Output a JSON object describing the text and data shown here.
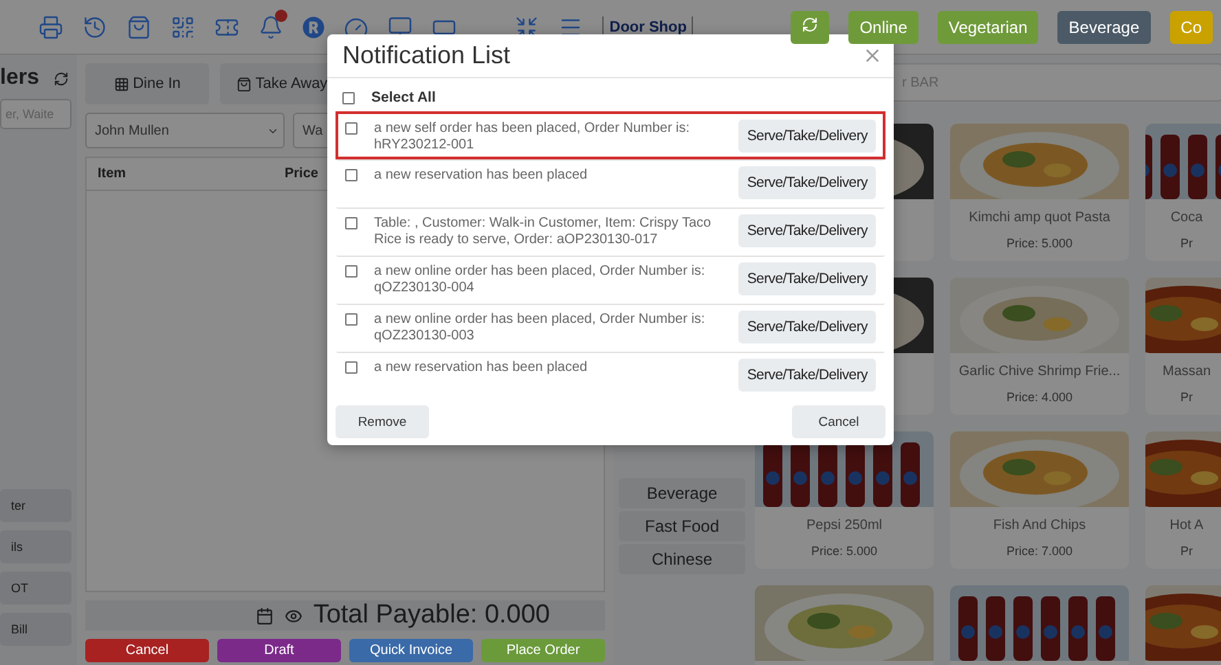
{
  "topbar": {
    "shop": "Door Shop",
    "badge": true,
    "filters": [
      {
        "label": "Online",
        "color": "#6f9a3a"
      },
      {
        "label": "Vegetarian",
        "color": "#6f9a3a"
      },
      {
        "label": "Beverage",
        "color": "#4b5a66"
      },
      {
        "label": "Co",
        "color": "#c9a200"
      }
    ]
  },
  "orders_panel": {
    "title": "lers",
    "search_placeholder": "er, Waite",
    "actions": [
      "ter",
      "ils",
      "OT",
      "Bill"
    ]
  },
  "order": {
    "tabs": [
      {
        "label": "Dine In",
        "kind": "table",
        "selected": false
      },
      {
        "label": "Take Away",
        "kind": "bag",
        "selected": false
      }
    ],
    "customer": "John Mullen",
    "waiter": "Wa",
    "columns": [
      "Item",
      "Price"
    ],
    "total": "Total Payable: 0.000",
    "buttons": [
      {
        "label": "Cancel",
        "color": "#a82222"
      },
      {
        "label": "Draft",
        "color": "#7b2a8a"
      },
      {
        "label": "Quick Invoice",
        "color": "#3a6aa8"
      },
      {
        "label": "Place Order",
        "color": "#6a9a3a"
      }
    ]
  },
  "categories": [
    {
      "label": "Beverage"
    },
    {
      "label": "Fast Food"
    },
    {
      "label": "Chinese"
    }
  ],
  "product_search": {
    "placeholder": "r BAR"
  },
  "products": [
    {
      "kind": "picture"
    },
    {
      "kind": "picture",
      "name": "Kimchi amp quot Pasta",
      "price": "Price: 5.000"
    },
    {
      "kind": "picture",
      "name": "Coca",
      "price": "Pr"
    },
    {
      "kind": "picture"
    },
    {
      "kind": "picture",
      "name": "Garlic Chive Shrimp Frie...",
      "price": "Price: 4.000"
    },
    {
      "kind": "picture",
      "name": "Massan",
      "price": "Pr"
    },
    {
      "kind": "picture",
      "name": "Pepsi 250ml",
      "price": "Price: 5.000"
    },
    {
      "kind": "picture",
      "name": "Fish And Chips",
      "price": "Price: 7.000"
    },
    {
      "kind": "picture",
      "name": "Hot A",
      "price": "Pr"
    },
    {
      "kind": "picture"
    },
    {
      "kind": "picture"
    },
    {
      "kind": "picture"
    }
  ],
  "modal": {
    "title": "Notification List",
    "select_all": {
      "label": "Select All",
      "checked": false
    },
    "notifications": [
      {
        "text": "a new self order has been placed, Order Number is: hRY230212-001",
        "action": "Serve/Take/Delivery",
        "checked": false,
        "selected": true
      },
      {
        "text": "a new reservation has been placed",
        "action": "Serve/Take/Delivery",
        "checked": false,
        "selected": false
      },
      {
        "text": "Table: , Customer: Walk-in Customer, Item: Crispy Taco Rice is ready to serve, Order: aOP230130-017",
        "action": "Serve/Take/Delivery",
        "checked": false,
        "selected": false
      },
      {
        "text": "a new online order has been placed, Order Number is: qOZ230130-004",
        "action": "Serve/Take/Delivery",
        "checked": false,
        "selected": false
      },
      {
        "text": "a new online order has been placed, Order Number is: qOZ230130-003",
        "action": "Serve/Take/Delivery",
        "checked": false,
        "selected": false
      },
      {
        "text": "a new reservation has been placed",
        "action": "Serve/Take/Delivery",
        "checked": false,
        "selected": false
      }
    ],
    "buttons": [
      "Remove",
      "Cancel"
    ]
  }
}
